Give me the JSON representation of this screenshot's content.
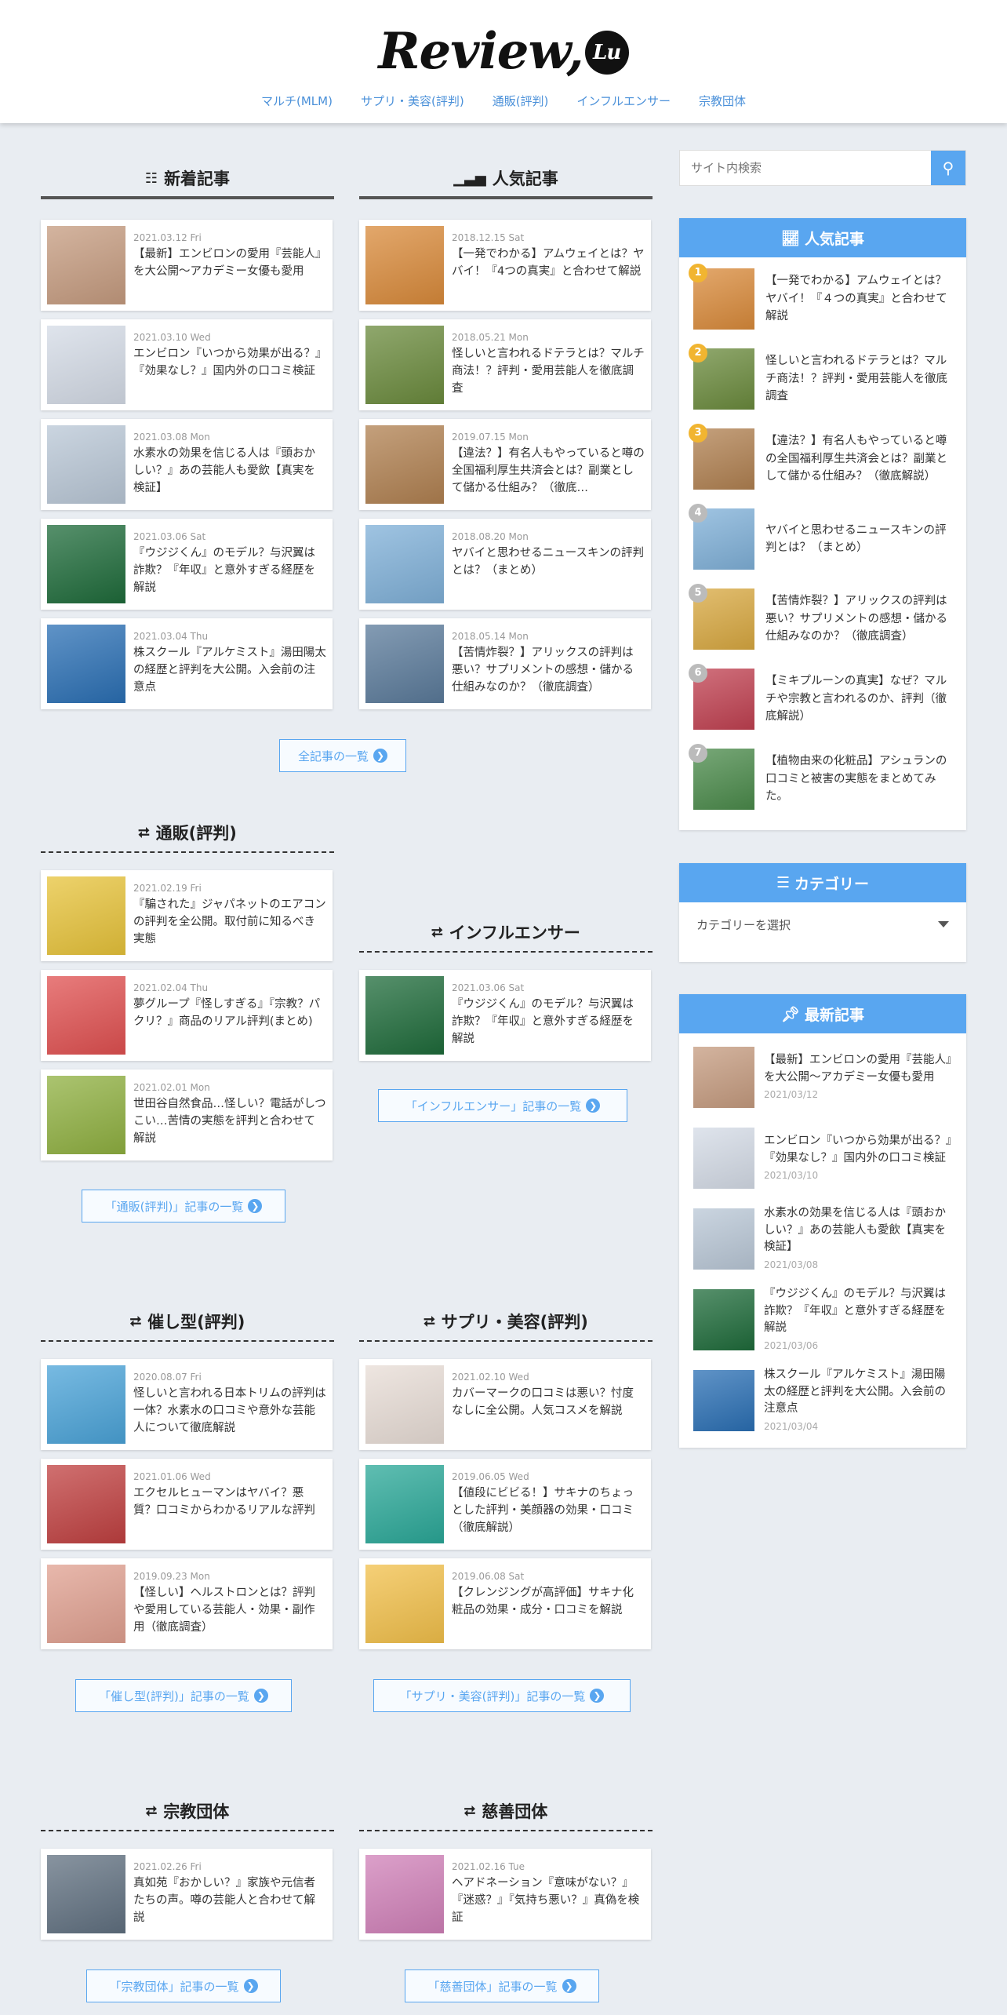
{
  "header": {
    "logo": "Review,",
    "logo_mark": "Lu",
    "nav": [
      "マルチ(MLM)",
      "サプリ・美容(評判)",
      "通販(評判)",
      "インフルエンサー",
      "宗教団体"
    ]
  },
  "sections": {
    "new": {
      "title": "新着記事",
      "more": "全記事の一覧",
      "items": [
        {
          "date": "2021.03.12 Fri",
          "title": "【最新】エンビロンの愛用『芸能人』を大公開～アカデミー女優も愛用",
          "color": "#c59b7f"
        },
        {
          "date": "2021.03.10 Wed",
          "title": "エンビロン『いつから効果が出る？』『効果なし？』国内外の口コミ検証",
          "color": "#d4dbe6"
        },
        {
          "date": "2021.03.08 Mon",
          "title": "水素水の効果を信じる人は『頭おかしい？』あの芸能人も愛飲【真実を検証】",
          "color": "#b9c7d6"
        },
        {
          "date": "2021.03.06 Sat",
          "title": "『ウジジくん』のモデル？与沢翼は詐欺？『年収』と意外すぎる経歴を解説",
          "color": "#1e6b3a"
        },
        {
          "date": "2021.03.04 Thu",
          "title": "株スクール『アルケミスト』湯田陽太の経歴と評判を大公開。入会前の注意点",
          "color": "#2a6fb4"
        }
      ]
    },
    "popular": {
      "title": "人気記事",
      "items": [
        {
          "date": "2018.12.15 Sat",
          "title": "【一発でわかる】アムウェイとは？ヤバイ！『4つの真実』と合わせて解説",
          "color": "#d98a3a"
        },
        {
          "date": "2018.05.21 Mon",
          "title": "怪しいと言われるドテラとは？マルチ商法！？評判・愛用芸能人を徹底調査",
          "color": "#6a8a3c"
        },
        {
          "date": "2019.07.15 Mon",
          "title": "【違法？】有名人もやっていると噂の全国福利厚生共済会とは？副業として儲かる仕組み？（徹底…",
          "color": "#b08050"
        },
        {
          "date": "2018.08.20 Mon",
          "title": "ヤバイと思わせるニュースキンの評判とは？（まとめ）",
          "color": "#7fb0d8"
        },
        {
          "date": "2018.05.14 Mon",
          "title": "【苦情炸裂？】アリックスの評判は悪い？サプリメントの感想・儲かる仕組みなのか？（徹底調査）",
          "color": "#5a7a9a"
        }
      ]
    },
    "tsuhan": {
      "title": "通販(評判)",
      "more": "「通販(評判)」記事の一覧",
      "items": [
        {
          "date": "2021.02.19 Fri",
          "title": "『騙された』ジャパネットのエアコンの評判を全公開。取付前に知るべき実態",
          "color": "#e7c33a"
        },
        {
          "date": "2021.02.04 Thu",
          "title": "夢グループ『怪しすぎる』『宗教？パクリ？』商品のリアル評判(まとめ)",
          "color": "#e05050"
        },
        {
          "date": "2021.02.01 Mon",
          "title": "世田谷自然食品…怪しい？電話がしつこい…苦情の実態を評判と合わせて解説",
          "color": "#8fb040"
        }
      ]
    },
    "influencer": {
      "title": "インフルエンサー",
      "more": "「インフルエンサー」記事の一覧",
      "items": [
        {
          "date": "2021.03.06 Sat",
          "title": "『ウジジくん』のモデル？与沢翼は詐欺？『年収』と意外すぎる経歴を解説",
          "color": "#1e6b3a"
        }
      ]
    },
    "saimin": {
      "title": "催し型(評判)",
      "more": "「催し型(評判)」記事の一覧",
      "items": [
        {
          "date": "2020.08.07 Fri",
          "title": "怪しいと言われる日本トリムの評判は一体？水素水の口コミや意外な芸能人について徹底解説",
          "color": "#4aa3d8"
        },
        {
          "date": "2021.01.06 Wed",
          "title": "エクセルヒューマンはヤバイ？悪質？口コミからわかるリアルな評判",
          "color": "#c04040"
        },
        {
          "date": "2019.09.23 Mon",
          "title": "【怪しい】ヘルストロンとは？評判や愛用している芸能人・効果・副作用（徹底調査）",
          "color": "#e0a090"
        }
      ]
    },
    "supple": {
      "title": "サプリ・美容(評判)",
      "more": "「サプリ・美容(評判)」記事の一覧",
      "items": [
        {
          "date": "2021.02.10 Wed",
          "title": "カバーマークの口コミは悪い？忖度なしに全公開。人気コスメを解説",
          "color": "#e8ddd6"
        },
        {
          "date": "2019.06.05 Wed",
          "title": "【値段にビビる！】サキナのちょっとした評判・美顔器の効果・口コミ（徹底解説）",
          "color": "#2aa898"
        },
        {
          "date": "2019.06.08 Sat",
          "title": "【クレンジングが高評価】サキナ化粧品の効果・成分・口コミを解説",
          "color": "#f2c04a"
        }
      ]
    },
    "shukyo": {
      "title": "宗教団体",
      "more": "「宗教団体」記事の一覧",
      "items": [
        {
          "date": "2021.02.26 Fri",
          "title": "真如苑『おかしい？』家族や元信者たちの声。噂の芸能人と合わせて解説",
          "color": "#607080"
        }
      ]
    },
    "jizen": {
      "title": "慈善団体",
      "more": "「慈善団体」記事の一覧",
      "items": [
        {
          "date": "2021.02.16 Tue",
          "title": "ヘアドネーション『意味がない？』『迷惑？』『気持ち悪い？』真偽を検証",
          "color": "#d080b8"
        }
      ]
    }
  },
  "sidebar": {
    "search_placeholder": "サイト内検索",
    "ranking": {
      "title": "人気記事",
      "items": [
        {
          "n": "1",
          "title": "【一発でわかる】アムウェイとは？ヤバイ！『４つの真実』と合わせて解説",
          "color": "#d98a3a"
        },
        {
          "n": "2",
          "title": "怪しいと言われるドテラとは？マルチ商法！？評判・愛用芸能人を徹底調査",
          "color": "#6a8a3c"
        },
        {
          "n": "3",
          "title": "【違法？】有名人もやっていると噂の全国福利厚生共済会とは？副業として儲かる仕組み？（徹底解説）",
          "color": "#b08050"
        },
        {
          "n": "4",
          "title": "ヤバイと思わせるニュースキンの評判とは？（まとめ）",
          "color": "#7fb0d8"
        },
        {
          "n": "5",
          "title": "【苦情炸裂？】アリックスの評判は悪い？サプリメントの感想・儲かる仕組みなのか？（徹底調査）",
          "color": "#d8a840"
        },
        {
          "n": "6",
          "title": "【ミキプルーンの真実】なぜ？マルチや宗教と言われるのか、評判（徹底解説）",
          "color": "#c04050"
        },
        {
          "n": "7",
          "title": "【植物由来の化粧品】アシュランの口コミと被害の実態をまとめてみた。",
          "color": "#4a8a4a"
        }
      ]
    },
    "category": {
      "title": "カテゴリー",
      "select": "カテゴリーを選択"
    },
    "latest": {
      "title": "最新記事",
      "items": [
        {
          "title": "【最新】エンビロンの愛用『芸能人』を大公開～アカデミー女優も愛用",
          "date": "2021/03/12",
          "color": "#c59b7f"
        },
        {
          "title": "エンビロン『いつから効果が出る？』『効果なし？』国内外の口コミ検証",
          "date": "2021/03/10",
          "color": "#d4dbe6"
        },
        {
          "title": "水素水の効果を信じる人は『頭おかしい？』あの芸能人も愛飲【真実を検証】",
          "date": "2021/03/08",
          "color": "#b9c7d6"
        },
        {
          "title": "『ウジジくん』のモデル？与沢翼は詐欺？『年収』と意外すぎる経歴を解説",
          "date": "2021/03/06",
          "color": "#1e6b3a"
        },
        {
          "title": "株スクール『アルケミスト』湯田陽太の経歴と評判を大公開。入会前の注意点",
          "date": "2021/03/04",
          "color": "#2a6fb4"
        }
      ]
    }
  }
}
